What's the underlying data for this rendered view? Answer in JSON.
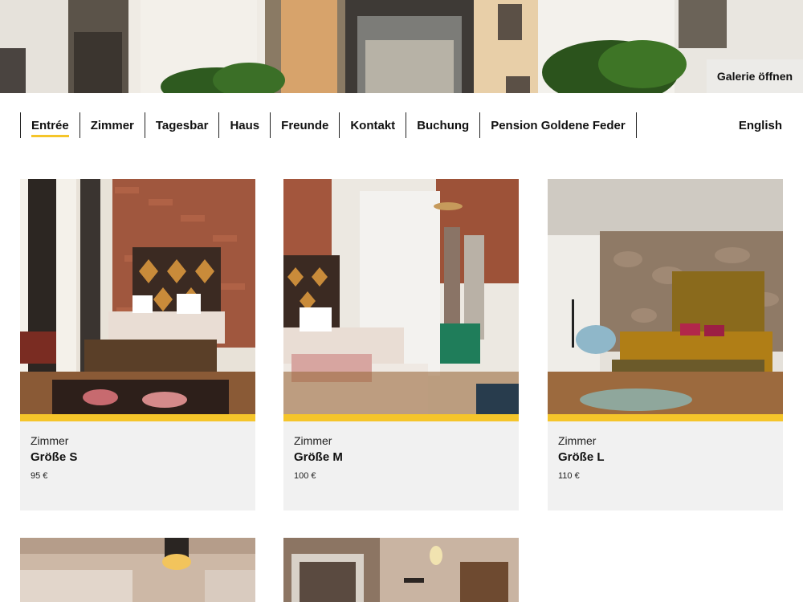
{
  "hero": {
    "gallery_label": "Galerie öffnen"
  },
  "nav": {
    "items": [
      {
        "label": "Entrée",
        "active": true
      },
      {
        "label": "Zimmer"
      },
      {
        "label": "Tagesbar"
      },
      {
        "label": "Haus"
      },
      {
        "label": "Freunde"
      },
      {
        "label": "Kontakt"
      },
      {
        "label": "Buchung"
      },
      {
        "label": "Pension Goldene Feder"
      }
    ],
    "language": "English"
  },
  "accent_color": "#f5c52a",
  "rooms": [
    {
      "category": "Zimmer",
      "name": "Größe S",
      "price": "95 €"
    },
    {
      "category": "Zimmer",
      "name": "Größe M",
      "price": "100 €"
    },
    {
      "category": "Zimmer",
      "name": "Größe L",
      "price": "110 €"
    }
  ]
}
